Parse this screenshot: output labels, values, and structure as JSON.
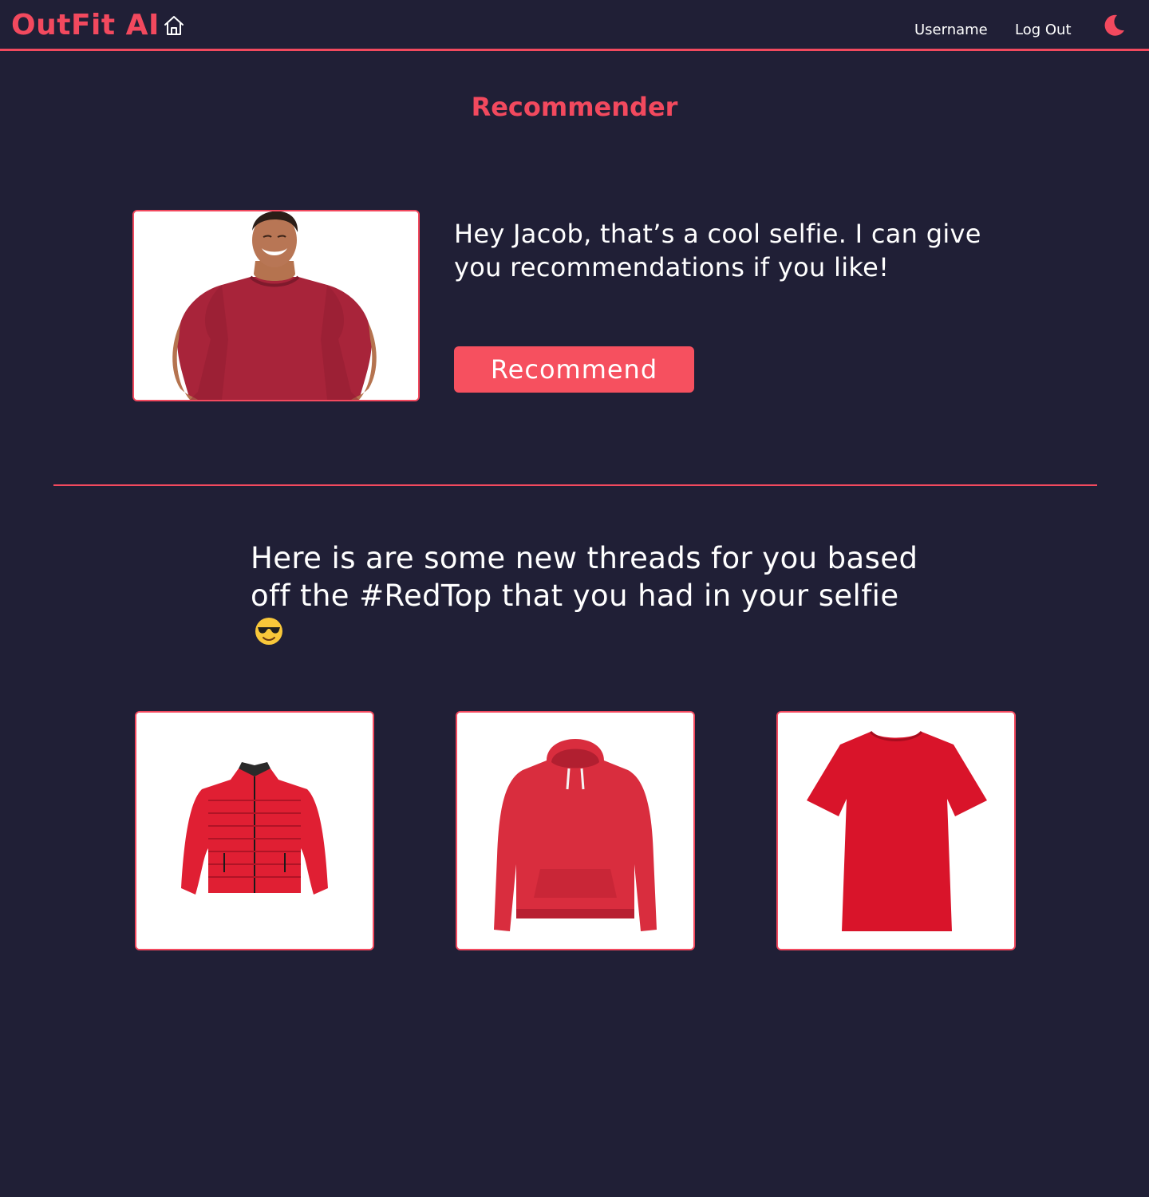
{
  "app": {
    "brand": "OutFit AI"
  },
  "nav": {
    "username_label": "Username",
    "logout_label": "Log Out"
  },
  "page": {
    "title": "Recommender"
  },
  "selfie": {
    "message": "Hey Jacob, that’s a cool selfie.  I can give you recommendations if you like!",
    "button_label": "Recommend"
  },
  "results": {
    "text": "Here is are some new threads for you based off the #RedTop that you had in your selfie",
    "emoji": "smiling-face-with-sunglasses-icon"
  },
  "recommendations": [
    {
      "item": "red-puffer-jacket-image"
    },
    {
      "item": "red-hoodie-image"
    },
    {
      "item": "red-tshirt-image"
    }
  ],
  "theme": {
    "background": "#201f36",
    "accent": "#f2495e",
    "text": "#ffffff"
  }
}
